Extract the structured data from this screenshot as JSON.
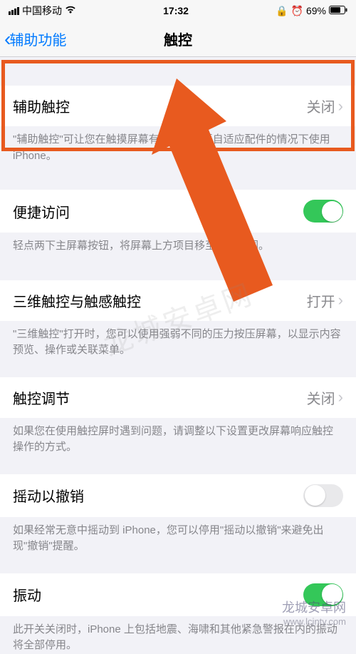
{
  "status": {
    "carrier": "中国移动",
    "time": "17:32",
    "battery": "69%"
  },
  "nav": {
    "back": "辅助功能",
    "title": "触控"
  },
  "sections": {
    "assistive": {
      "label": "辅助触控",
      "value": "关闭",
      "footer": "\"辅助触控\"可让您在触摸屏幕有困难或需要自适应配件的情况下使用 iPhone。"
    },
    "reachability": {
      "label": "便捷访问",
      "footer": "轻点两下主屏幕按钮，将屏幕上方项目移至可及范围。"
    },
    "threed": {
      "label": "三维触控与触感触控",
      "value": "打开",
      "footer": "\"三维触控\"打开时，您可以使用强弱不同的压力按压屏幕，以显示内容预览、操作或关联菜单。"
    },
    "accom": {
      "label": "触控调节",
      "value": "关闭",
      "footer": "如果您在使用触控屏时遇到问题，请调整以下设置更改屏幕响应触控操作的方式。"
    },
    "shake": {
      "label": "摇动以撤销",
      "footer": "如果经常无意中摇动到 iPhone，您可以停用\"摇动以撤销\"来避免出现\"撤销\"提醒。"
    },
    "vibration": {
      "label": "振动",
      "footer": "此开关关闭时，iPhone 上包括地震、海啸和其他紧急警报在内的振动将全部停用。"
    }
  },
  "watermark": {
    "center": "龙城安卓网",
    "title": "龙城安卓网",
    "url": "www.lcjnty.com"
  }
}
